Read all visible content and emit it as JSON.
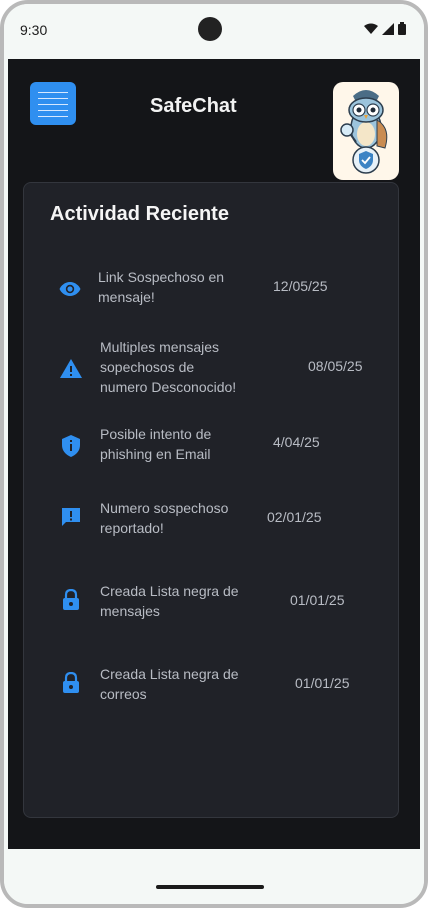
{
  "status_bar": {
    "time": "9:30"
  },
  "header": {
    "title": "SafeChat"
  },
  "activity": {
    "title": "Actividad Reciente",
    "items": [
      {
        "icon": "eye-icon",
        "text_line1": "Link Sospechoso en",
        "text_line2": "mensaje!",
        "text_line3": "",
        "date": "12/05/25"
      },
      {
        "icon": "warning-icon",
        "text_line1": "Multiples mensajes",
        "text_line2": "sopechosos de",
        "text_line3": "numero Desconocido!",
        "date": "08/05/25"
      },
      {
        "icon": "shield-info-icon",
        "text_line1": "Posible intento de",
        "text_line2": "phishing en Email",
        "text_line3": "",
        "date": "4/04/25"
      },
      {
        "icon": "report-icon",
        "text_line1": "Numero sospechoso",
        "text_line2": "reportado!",
        "text_line3": "",
        "date": "02/01/25"
      },
      {
        "icon": "lock-icon",
        "text_line1": "Creada Lista negra de",
        "text_line2": "mensajes",
        "text_line3": "",
        "date": "01/01/25"
      },
      {
        "icon": "lock-icon",
        "text_line1": "Creada Lista negra de",
        "text_line2": "correos",
        "text_line3": "",
        "date": "01/01/25"
      }
    ]
  },
  "colors": {
    "accent": "#2f8ff0",
    "background": "#141518",
    "card": "#202228",
    "text": "#b8bcc4"
  }
}
